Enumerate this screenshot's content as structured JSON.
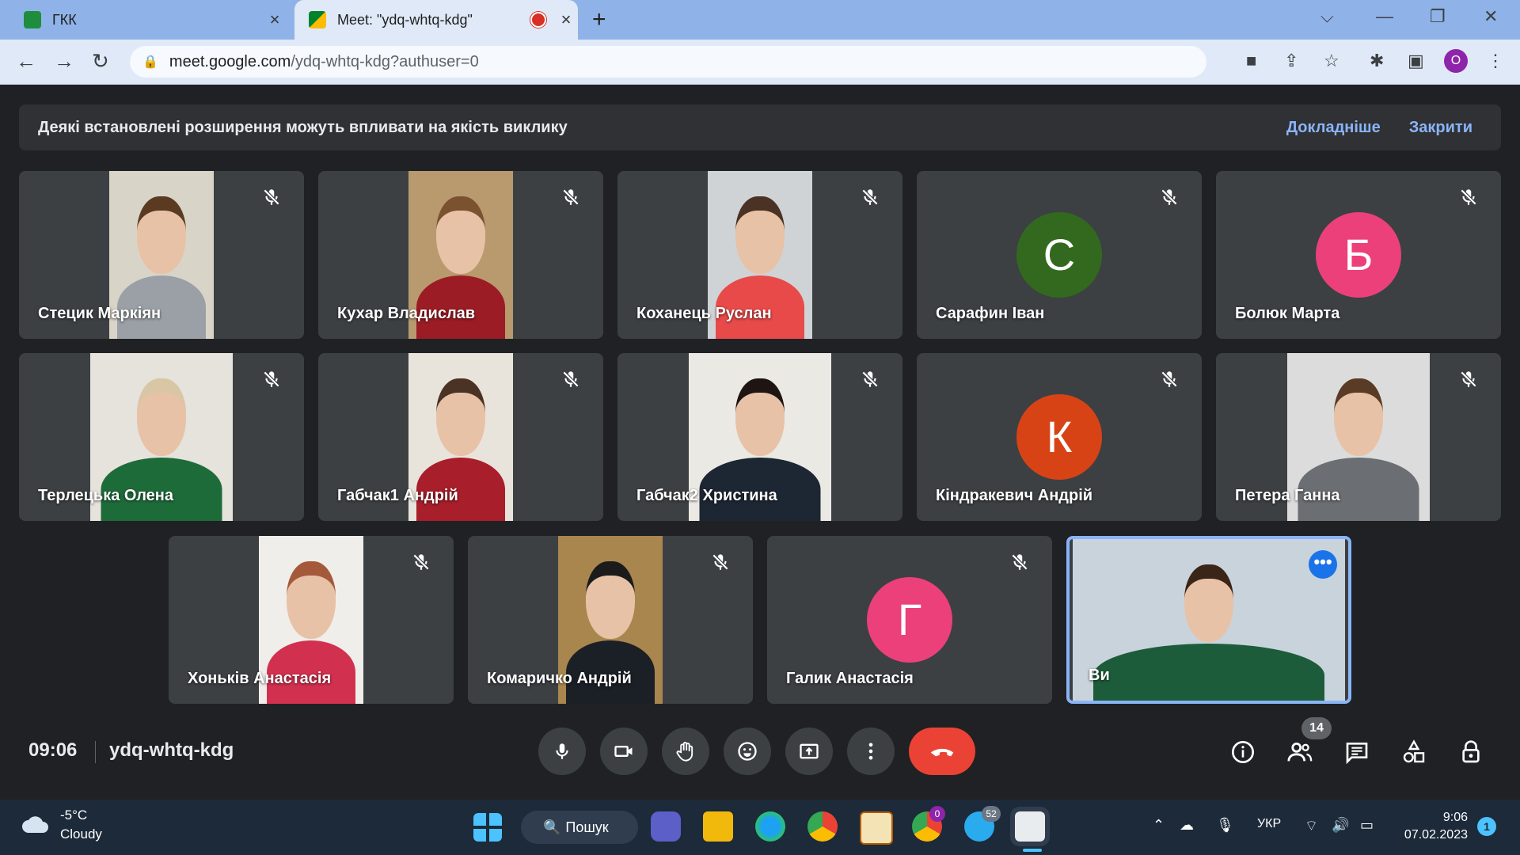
{
  "browser": {
    "tabs": [
      {
        "title": "ГКК",
        "close": "×"
      },
      {
        "title": "Meet: \"ydq-whtq-kdg\"",
        "close": "×"
      }
    ],
    "new_tab": "+",
    "url_host": "meet.google.com",
    "url_path": "/ydq-whtq-kdg?authuser=0",
    "profile_initial": "O"
  },
  "banner": {
    "message": "Деякі встановлені розширення можуть впливати на якість виклику",
    "learn_more": "Докладніше",
    "close": "Закрити"
  },
  "participants": [
    {
      "name": "Стецик Маркіян",
      "type": "video",
      "muted": true
    },
    {
      "name": "Кухар Владислав",
      "type": "video",
      "muted": true
    },
    {
      "name": "Коханець Руслан",
      "type": "video",
      "muted": true
    },
    {
      "name": "Сарафин Іван",
      "type": "avatar",
      "initial": "С",
      "color": "#33691e",
      "muted": true
    },
    {
      "name": "Болюк Марта",
      "type": "avatar",
      "initial": "Б",
      "color": "#ec407a",
      "muted": true
    },
    {
      "name": "Терлецька Олена",
      "type": "video",
      "muted": true
    },
    {
      "name": "Габчак1 Андрій",
      "type": "video",
      "muted": true
    },
    {
      "name": "Габчак2 Христина",
      "type": "video",
      "muted": true
    },
    {
      "name": "Кіндракевич Андрій",
      "type": "avatar",
      "initial": "К",
      "color": "#d84315",
      "muted": true
    },
    {
      "name": "Петера Ганна",
      "type": "video",
      "muted": true
    },
    {
      "name": "Хоньків Анастасія",
      "type": "video",
      "muted": true
    },
    {
      "name": "Комаричко Андрій",
      "type": "video",
      "muted": true
    },
    {
      "name": "Галик Анастасія",
      "type": "avatar",
      "initial": "Г",
      "color": "#ec407a",
      "muted": true
    },
    {
      "name": "Ви",
      "type": "self",
      "muted": false
    }
  ],
  "meeting": {
    "time": "09:06",
    "code": "ydq-whtq-kdg",
    "participant_count": "14",
    "more_options": "•••"
  },
  "taskbar": {
    "temperature": "-5°C",
    "condition": "Cloudy",
    "search_label": "Пошук",
    "chrome_badge": "0",
    "telegram_badge": "52",
    "language": "УКР",
    "time": "9:06",
    "date": "07.02.2023",
    "notifications": "1"
  },
  "colors": {
    "meet_bg": "#202124",
    "tile_bg": "#3c4043",
    "accent": "#8ab4f8",
    "end_call": "#ea4335"
  }
}
